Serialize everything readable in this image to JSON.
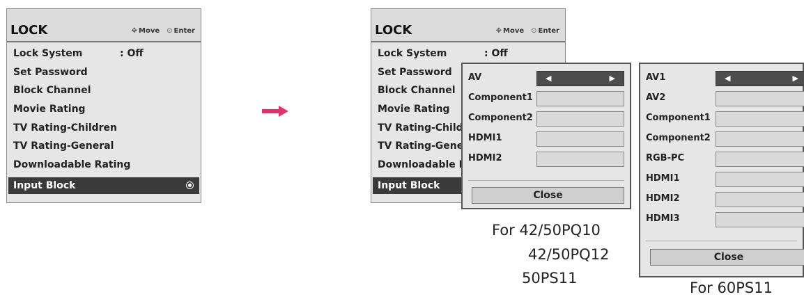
{
  "left_menu": {
    "title": "LOCK",
    "hint_move_icon": "move-arrows-icon",
    "hint_move": "Move",
    "hint_enter_icon": "enter-icon",
    "hint_enter": "Enter",
    "items": [
      {
        "label": "Lock System",
        "value": ": Off"
      },
      {
        "label": "Set Password"
      },
      {
        "label": "Block Channel"
      },
      {
        "label": "Movie Rating"
      },
      {
        "label": "TV Rating-Children"
      },
      {
        "label": "TV Rating-General"
      },
      {
        "label": "Downloadable Rating"
      },
      {
        "label": "Input Block",
        "selected": true
      }
    ]
  },
  "right_menu": {
    "title": "LOCK",
    "hint_move": "Move",
    "hint_enter": "Enter",
    "items": [
      {
        "label": "Lock System",
        "value": ": Off"
      },
      {
        "label": "Set Password"
      },
      {
        "label": "Block Channel"
      },
      {
        "label": "Movie Rating"
      },
      {
        "label": "TV Rating-Children"
      },
      {
        "label": "TV Rating-General"
      },
      {
        "label": "Downloadable Rating"
      },
      {
        "label": "Input Block",
        "selected": true
      }
    ]
  },
  "popup_a": {
    "rows": [
      "AV",
      "Component1",
      "Component2",
      "HDMI1",
      "HDMI2"
    ],
    "close_label": "Close",
    "caption_lines": [
      "For 42/50PQ10",
      "42/50PQ12",
      "50PS11"
    ]
  },
  "popup_b": {
    "rows": [
      "AV1",
      "AV2",
      "Component1",
      "Component2",
      "RGB-PC",
      "HDMI1",
      "HDMI2",
      "HDMI3"
    ],
    "close_label": "Close",
    "caption": "For 60PS11"
  },
  "arrow_color": "#e0336a",
  "selected_color": "#3a3a3a"
}
